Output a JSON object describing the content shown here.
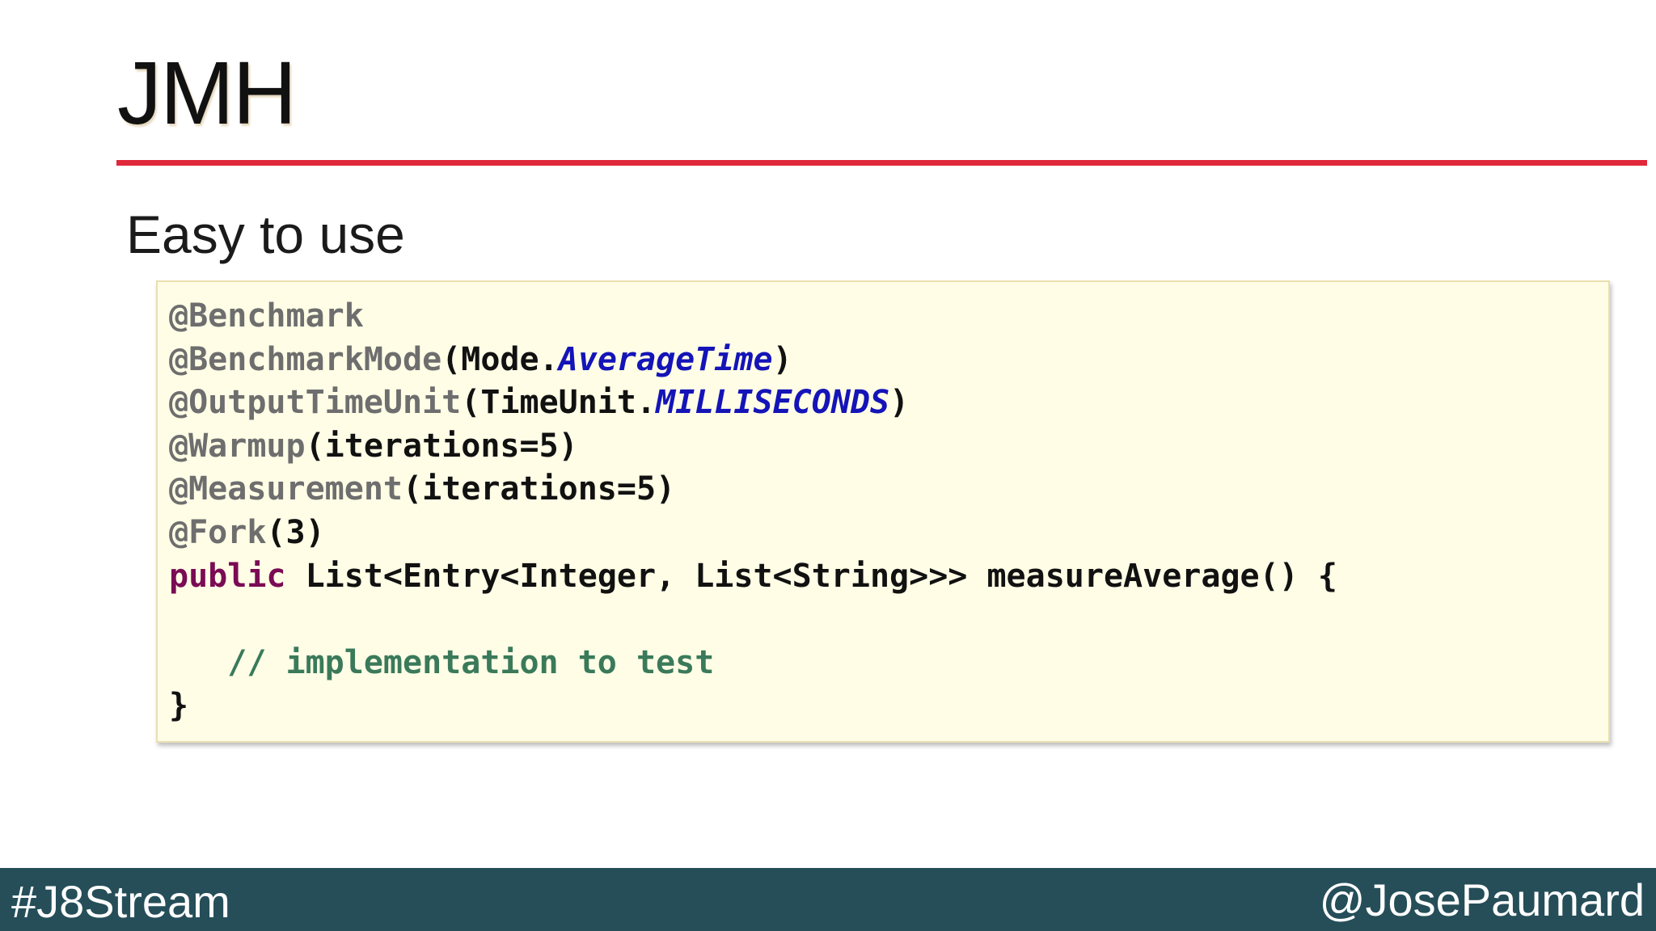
{
  "slide": {
    "title": "JMH",
    "subtitle": "Easy to use",
    "accent_color": "#e0283a",
    "code_background": "#fffde6"
  },
  "code": {
    "lines": [
      [
        {
          "text": "@Benchmark",
          "kind": "ann"
        }
      ],
      [
        {
          "text": "@BenchmarkMode",
          "kind": "ann"
        },
        {
          "text": "(Mode.",
          "kind": "plain"
        },
        {
          "text": "AverageTime",
          "kind": "const"
        },
        {
          "text": ")",
          "kind": "plain"
        }
      ],
      [
        {
          "text": "@OutputTimeUnit",
          "kind": "ann"
        },
        {
          "text": "(TimeUnit.",
          "kind": "plain"
        },
        {
          "text": "MILLISECONDS",
          "kind": "const"
        },
        {
          "text": ")",
          "kind": "plain"
        }
      ],
      [
        {
          "text": "@Warmup",
          "kind": "ann"
        },
        {
          "text": "(iterations=5)",
          "kind": "plain"
        }
      ],
      [
        {
          "text": "@Measurement",
          "kind": "ann"
        },
        {
          "text": "(iterations=5)",
          "kind": "plain"
        }
      ],
      [
        {
          "text": "@Fork",
          "kind": "ann"
        },
        {
          "text": "(3)",
          "kind": "plain"
        }
      ],
      [
        {
          "text": "public",
          "kind": "kw"
        },
        {
          "text": " List<Entry<Integer, List<String>>> measureAverage() {",
          "kind": "plain"
        }
      ],
      [],
      [
        {
          "text": "   // implementation to test",
          "kind": "comment"
        }
      ],
      [
        {
          "text": "}",
          "kind": "plain"
        }
      ]
    ]
  },
  "footer": {
    "hashtag": "#J8Stream",
    "handle": "@JosePaumard",
    "background": "#254e59"
  }
}
